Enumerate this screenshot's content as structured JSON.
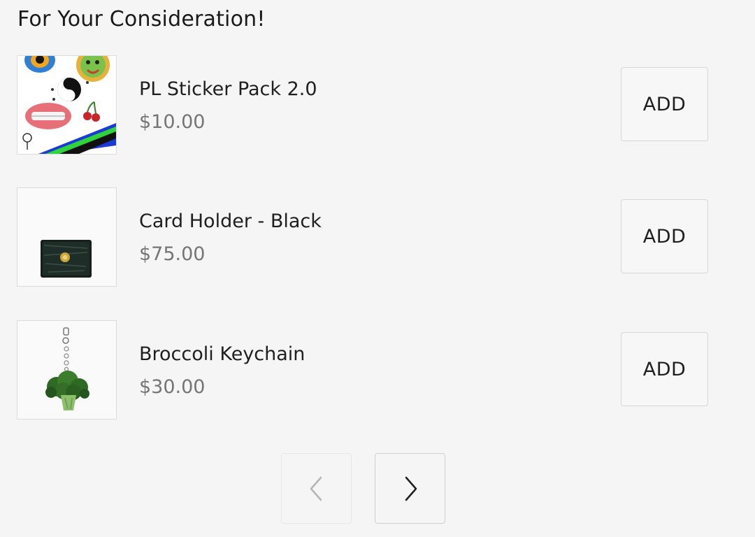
{
  "section": {
    "title": "For Your Consideration!"
  },
  "products": [
    {
      "name": "PL Sticker Pack 2.0",
      "price": "$10.00",
      "action_label": "ADD",
      "image_icon": "sticker-pack-thumbnail"
    },
    {
      "name": "Card Holder - Black",
      "price": "$75.00",
      "action_label": "ADD",
      "image_icon": "card-holder-thumbnail"
    },
    {
      "name": "Broccoli Keychain",
      "price": "$30.00",
      "action_label": "ADD",
      "image_icon": "broccoli-keychain-thumbnail"
    }
  ],
  "pagination": {
    "prev_icon": "chevron-left-icon",
    "next_icon": "chevron-right-icon",
    "prev_enabled": false,
    "next_enabled": true
  },
  "colors": {
    "background": "#f5f5f5",
    "text": "#1f1f1f",
    "price_text": "#757575",
    "border": "#d6d6d6",
    "disabled_icon": "#b5b5b5"
  }
}
